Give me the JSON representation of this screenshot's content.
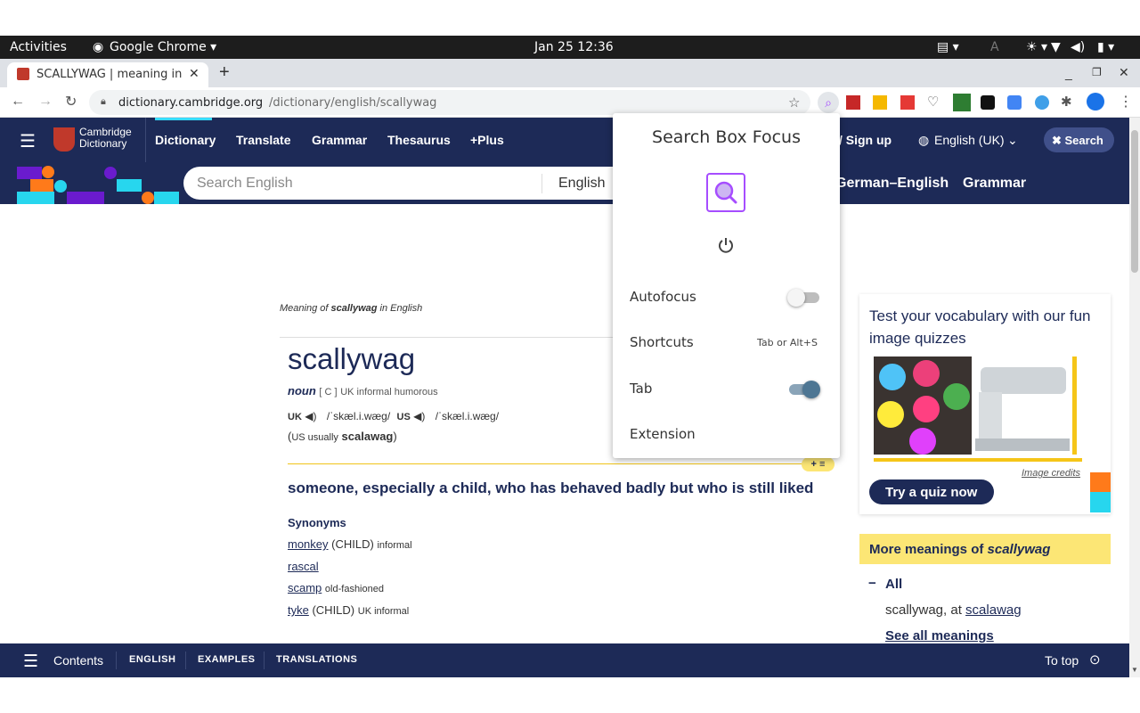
{
  "os": {
    "activities": "Activities",
    "app": "Google Chrome ▾",
    "datetime": "Jan 25  12:36"
  },
  "browser": {
    "tab_title": "SCALLYWAG | meaning in",
    "url_host": "dictionary.cambridge.org",
    "url_path": "/dictionary/english/scallywag"
  },
  "site": {
    "logo_line1": "Cambridge",
    "logo_line2": "Dictionary",
    "nav": [
      "Dictionary",
      "Translate",
      "Grammar",
      "Thesaurus",
      "+Plus"
    ],
    "signup": "/ Sign up",
    "lang": "English (UK)",
    "search_btn": "✖ Search",
    "search_placeholder": "Search English",
    "search_lang": "English",
    "sub_nav": [
      "German–English",
      "Grammar"
    ]
  },
  "entry": {
    "meaning_of_prefix": "Meaning of ",
    "meaning_word": "scallywag",
    "meaning_suffix": " in English",
    "headword": "scallywag",
    "pos": "noun",
    "gram": "[ C ]",
    "labels": "UK informal humorous",
    "uk": "UK",
    "uk_ipa": "/ˈskæl.i.wæɡ/",
    "us": "US",
    "us_ipa": "/ˈskæl.i.wæɡ/",
    "variant_prefix": "(",
    "variant_us": "US usually",
    "variant_word": "scalawag",
    "variant_suffix": ")",
    "definition": "someone, especially a child, who has behaved badly but who is still liked",
    "synonyms_title": "Synonyms",
    "synonyms": [
      {
        "word": "monkey",
        "extra": "(CHILD)",
        "label": "informal"
      },
      {
        "word": "rascal",
        "extra": "",
        "label": ""
      },
      {
        "word": "scamp",
        "extra": "",
        "label": "old-fashioned"
      },
      {
        "word": "tyke",
        "extra": "(CHILD)",
        "label": "UK informal"
      }
    ]
  },
  "sidebar": {
    "quiz_title": "Test your vocabulary with our fun image quizzes",
    "image_credits": "Image credits",
    "quiz_btn": "Try a quiz now",
    "more_prefix": "More meanings of ",
    "more_word": "scallywag",
    "all_label": "All",
    "row_text": "scallywag, at ",
    "row_link": "scalawag",
    "see_all": "See all meanings"
  },
  "bottom": {
    "contents": "Contents",
    "tabs": [
      "ENGLISH",
      "EXAMPLES",
      "TRANSLATIONS"
    ],
    "to_top": "To top"
  },
  "popup": {
    "title": "Search Box Focus",
    "autofocus_label": "Autofocus",
    "autofocus_on": false,
    "shortcuts_label": "Shortcuts",
    "shortcuts_value": "Tab or Alt+S",
    "tab_label": "Tab",
    "tab_on": true,
    "extension_label": "Extension"
  },
  "colors": {
    "cambridge_navy": "#1d2a57",
    "accent_yellow": "#fce675",
    "toggle_on": "#4e7693",
    "popup_icon": "#a64dff"
  }
}
